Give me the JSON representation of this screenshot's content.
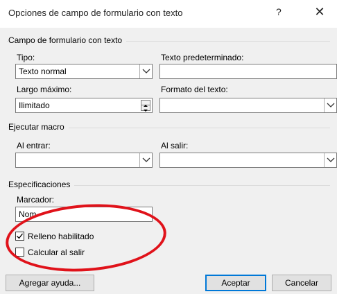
{
  "window": {
    "title": "Opciones de campo de formulario con texto",
    "help_glyph": "?",
    "close_glyph": "✕"
  },
  "group_text_field": {
    "label": "Campo de formulario con texto",
    "tipo_label": "Tipo:",
    "tipo_value": "Texto normal",
    "default_text_label": "Texto predeterminado:",
    "default_text_value": "",
    "max_length_label": "Largo máximo:",
    "max_length_value": "Ilimitado",
    "text_format_label": "Formato del texto:",
    "text_format_value": ""
  },
  "group_macro": {
    "label": "Ejecutar macro",
    "on_entry_label": "Al entrar:",
    "on_entry_value": "",
    "on_exit_label": "Al salir:",
    "on_exit_value": ""
  },
  "group_specs": {
    "label": "Especificaciones",
    "bookmark_label": "Marcador:",
    "bookmark_value": "Nom",
    "fill_enabled_label": "Relleno habilitado",
    "fill_enabled_checked": true,
    "calc_on_exit_label": "Calcular al salir",
    "calc_on_exit_checked": false
  },
  "buttons": {
    "add_help": "Agregar ayuda...",
    "ok": "Aceptar",
    "cancel": "Cancelar"
  },
  "annotation": {
    "color": "#e0121a"
  }
}
